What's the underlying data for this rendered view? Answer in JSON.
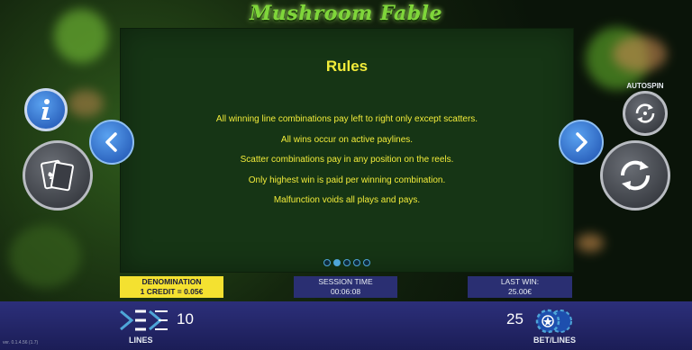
{
  "game": {
    "title": "Mushroom Fable"
  },
  "rules": {
    "title": "Rules",
    "lines": [
      "All winning line combinations pay left to right only except scatters.",
      "All wins occur on active paylines.",
      "Scatter combinations pay in any position on the reels.",
      "Only highest win is paid per winning combination.",
      "Malfunction voids all plays and pays."
    ],
    "page_count": 5,
    "current_page": 2
  },
  "buttons": {
    "info": "info-icon",
    "paytable": "playing-cards-icon",
    "prev": "chevron-left-icon",
    "next": "chevron-right-icon",
    "autospin_label": "AUTOSPIN",
    "spin": "spin-arrows-icon"
  },
  "status": {
    "denomination_label": "DENOMINATION",
    "denomination_value": "1 CREDIT = 0.05€",
    "session_label": "SESSION TIME",
    "session_value": "00:06:08",
    "lastwin_label": "LAST WIN:",
    "lastwin_value": "25.00€"
  },
  "bottom": {
    "lines_value": "10",
    "lines_label": "LINES",
    "bet_value": "25",
    "bet_label": "BET/LINES"
  },
  "version": "ver. 0.1.4.56 (1.7)",
  "colors": {
    "rules_text": "#f2ec3a",
    "panel": "#163515",
    "denomination_bg": "#f4e130",
    "bar": "#2a2f72",
    "accent_blue": "#4ea6d8"
  }
}
